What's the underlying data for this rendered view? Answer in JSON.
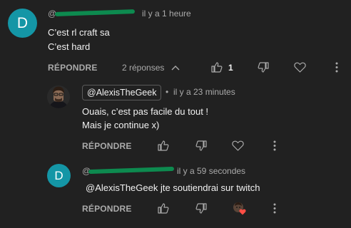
{
  "comment1": {
    "avatar_letter": "D",
    "username_prefix": "@",
    "timestamp": "il y a 1 heure",
    "lines": [
      "C’est rl craft sa",
      "C’est hard"
    ],
    "reply_label": "RÉPONDRE",
    "replies_label": "2 réponses",
    "like_count": "1"
  },
  "reply1": {
    "author_chip": "@AlexisTheGeek",
    "separator": "•",
    "timestamp": "il y a 23 minutes",
    "lines": [
      "Ouais, c’est pas facile du tout !",
      "Mais je continue x)"
    ],
    "reply_label": "RÉPONDRE"
  },
  "reply2": {
    "avatar_letter": "D",
    "username_prefix": "@",
    "timestamp": "il y a 59 secondes",
    "mention": "@AlexisTheGeek",
    "text": "jte soutiendrai sur twitch",
    "reply_label": "RÉPONDRE"
  },
  "colors": {
    "background": "#212121",
    "avatar_teal": "#1496a6",
    "redaction_green": "#0d8a4f",
    "heart_red": "#ff4e45"
  }
}
